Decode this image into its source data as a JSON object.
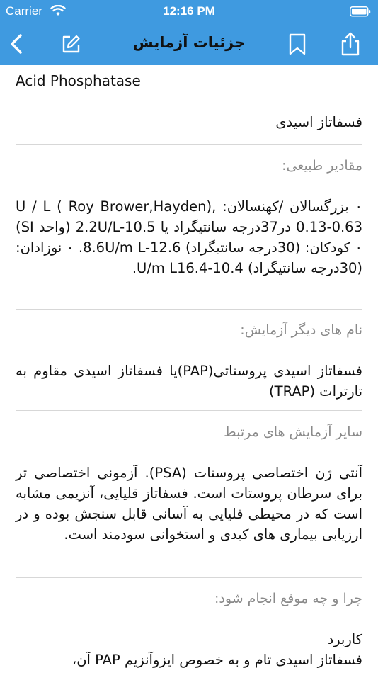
{
  "status_bar": {
    "carrier": "Carrier",
    "time": "12:16 PM"
  },
  "nav": {
    "title": "جزئیات آزمایش",
    "icons": [
      "back-chevron-icon",
      "edit-icon",
      "bookmark-icon",
      "share-icon"
    ],
    "accent_color": "#3f9ae0"
  },
  "detail": {
    "english_name": "Acid Phosphatase",
    "persian_name": "فسفاتاز اسیدی",
    "normal_values_label": "مقادیر طبیعی:",
    "normal_values_text": "٠ بزرگسالان /کهنسالان: ,U / L ( Roy Brower,Hayden) 0.13-0.63 در37درجه سانتیگراد یا 2.2U/L-10.5 (واحد SI) ٠ کودکان: (30درجه سانتیگراد) 8.6U/m L-12.6. ٠ نوزادان: (30درجه سانتیگراد) U/m L16.4-10.4.",
    "other_names_label": "نام های دیگر آزمایش:",
    "other_names_text": "فسفاتاز اسیدی پروستاتی(PAP)یا فسفاتاز اسیدی مقاوم به تارترات (TRAP)",
    "related_tests_label": "سایر آزمایش های مرتبط",
    "related_tests_text": "آنتی ژن اختصاصی پروستات (PSA). آزمونی اختصاصی تر برای سرطان پروستات است. فسفاتاز قلیایی، آنزیمی مشابه است که در محیطی قلیایی به آسانی قابل سنجش بوده و در ارزیابی بیماری های کبدی و استخوانی سودمند است.",
    "why_when_label": "چرا و چه موقع انجام شود:",
    "usage_heading": "کاربرد",
    "usage_text": "فسفاتاز اسیدی تام و به خصوص ایزوآنزیم PAP آن،"
  }
}
